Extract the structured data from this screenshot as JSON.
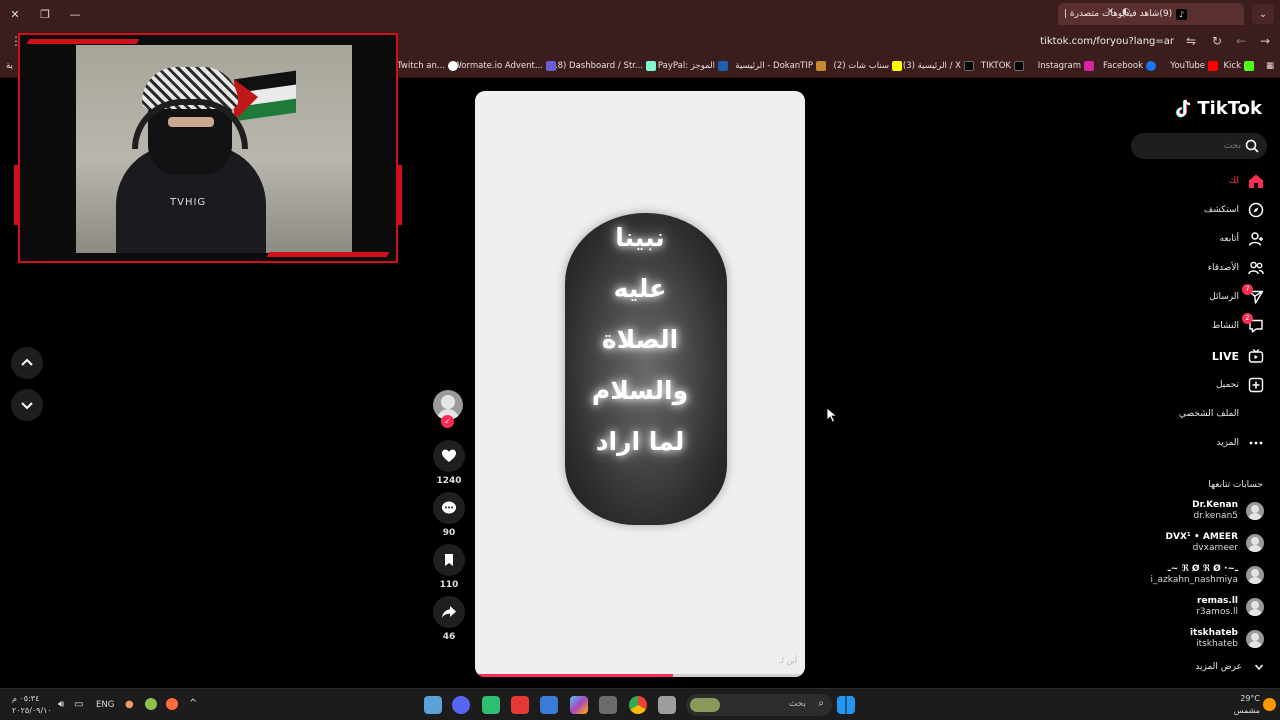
{
  "browser": {
    "tab_title": "(9)شاهد فيديوهات متصدرة |",
    "url": "tiktok.com/foryou?lang=ar",
    "bookmarks": [
      "Kick",
      "YouTube",
      "Facebook",
      "Instagram",
      "TIKTOK",
      "(3) الرئيسية / X",
      "(2) سناب شات",
      "الرئيسية - DokanTIP",
      "PayPal: الموجز",
      "(18) Dashboard / Str...",
      "Wormate.io Advent...",
      "Twitch an...",
      "ية"
    ]
  },
  "brand": {
    "name": "TikTok",
    "accent": "#fe2c55"
  },
  "search": {
    "placeholder": "بحث"
  },
  "nav": {
    "home": "لك",
    "explore": "استكشف",
    "following": "أتابعه",
    "friends": "الأصدقاء",
    "messages": "الرسائل",
    "messages_badge": "7",
    "activity": "النشاط",
    "activity_badge": "2",
    "live": "LIVE",
    "upload": "تحميل",
    "profile": "الملف الشخصي",
    "more": "المزيد"
  },
  "following_section": {
    "title": "حسابات تتابعها",
    "accounts": [
      {
        "name": "Dr.Kenan",
        "handle": "dr.kenan5"
      },
      {
        "name": "DVX¹ • AMEER",
        "handle": "dvxameer"
      },
      {
        "name": "ـ~ ℜ Ø ℜ Ø ·~ـ",
        "handle": "i_azkahn_nashmiya"
      },
      {
        "name": "remas.ll",
        "handle": "r3amos.ll"
      },
      {
        "name": "itskhateb",
        "handle": "itskhateb"
      }
    ],
    "see_more": "عرض المزيد"
  },
  "video": {
    "lines": [
      "نبينا",
      "عليه",
      "الصلاة",
      "والسلام",
      "لما اراد"
    ],
    "watermark": "أين لـ",
    "progress": 0.6
  },
  "actions": {
    "likes": "1240",
    "comments": "90",
    "saves": "110",
    "shares": "46"
  },
  "webcam": {
    "shirt_text": "TVHIG"
  },
  "taskbar": {
    "search_placeholder": "بحث",
    "language": "ENG",
    "time": "٠٥:٣٤ م",
    "date": "٢٠٢٥/٠٩/١٠",
    "temp": "29°C",
    "weather": "مشمس"
  }
}
